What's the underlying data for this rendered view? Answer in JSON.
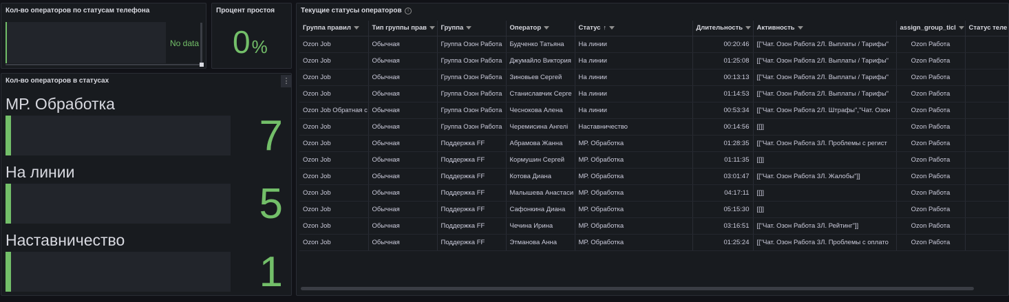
{
  "panel_phone_status": {
    "title": "Кол-во операторов по статусам телефона",
    "no_data": "No data"
  },
  "panel_idle": {
    "title": "Процент простоя",
    "value": "0",
    "unit": "%"
  },
  "panel_status_counts": {
    "title": "Кол-во операторов в статусах",
    "menu_icon": "⋮",
    "items": [
      {
        "label": "МР. Обработка",
        "value": "7"
      },
      {
        "label": "На линии",
        "value": "5"
      },
      {
        "label": "Наставничество",
        "value": "1"
      }
    ]
  },
  "panel_table": {
    "title": "Текущие статусы операторов",
    "info_icon": "i",
    "columns": [
      "Группа правил",
      "Тип группы прав",
      "Группа",
      "Оператор",
      "Статус",
      "Длительность",
      "Активность",
      "assign_group_ticl",
      "Статус теле"
    ],
    "rows": [
      [
        "Ozon Job",
        "Обычная",
        "Группа Озон Работа",
        "Будченко Татьяна",
        "На линии",
        "00:20:46",
        "[[\"Чат. Озон Работа 2Л. Выплаты / Тарифы\"",
        "Ozon Работа",
        ""
      ],
      [
        "Ozon Job",
        "Обычная",
        "Группа Озон Работа",
        "Джумайло Виктория",
        "На линии",
        "01:25:08",
        "[[\"Чат. Озон Работа 2Л. Выплаты / Тарифы\"",
        "Ozon Работа",
        ""
      ],
      [
        "Ozon Job",
        "Обычная",
        "Группа Озон Работа",
        "Зиновьев Сергей",
        "На линии",
        "00:13:13",
        "[[\"Чат. Озон Работа 2Л. Выплаты / Тарифы\"",
        "Ozon Работа",
        ""
      ],
      [
        "Ozon Job",
        "Обычная",
        "Группа Озон Работа",
        "Станиславчик Серге",
        "На линии",
        "01:14:53",
        "[[\"Чат. Озон Работа 2Л. Выплаты / Тарифы\"",
        "Ozon Работа",
        ""
      ],
      [
        "Ozon Job Обратная с",
        "Обычная",
        "Группа Озон Работа",
        "Чеснокова Алена",
        "На линии",
        "00:53:34",
        "[[\"Чат. Озон Работа 2Л. Штрафы\",\"Чат. Озон",
        "Ozon Работа",
        ""
      ],
      [
        "Ozon Job",
        "Обычная",
        "Группа Озон Работа",
        "Черемисина Ангелі",
        "Наставничество",
        "00:14:56",
        "[[]]",
        "Ozon Работа",
        ""
      ],
      [
        "Ozon Job",
        "Обычная",
        "Поддержка FF",
        "Абрамова Жанна",
        "МР. Обработка",
        "01:28:35",
        "[[\"Чат. Озон Работа 3Л. Проблемы с регист",
        "Ozon Работа",
        ""
      ],
      [
        "Ozon Job",
        "Обычная",
        "Поддержка FF",
        "Кормушин Сергей",
        "МР. Обработка",
        "01:11:35",
        "[[]]",
        "Ozon Работа",
        ""
      ],
      [
        "Ozon Job",
        "Обычная",
        "Поддержка FF",
        "Котова Диана",
        "МР. Обработка",
        "03:01:47",
        "[[\"Чат. Озон Работа 3Л. Жалобы\"]]",
        "Ozon Работа",
        ""
      ],
      [
        "Ozon Job",
        "Обычная",
        "Поддержка FF",
        "Малышева Анастаси",
        "МР. Обработка",
        "04:17:11",
        "[[]]",
        "Ozon Работа",
        ""
      ],
      [
        "Ozon Job",
        "Обычная",
        "Поддержка FF",
        "Сафонкина Диана",
        "МР. Обработка",
        "05:15:30",
        "[[]]",
        "Ozon Работа",
        ""
      ],
      [
        "Ozon Job",
        "Обычная",
        "Поддержка FF",
        "Чечина Ирина",
        "МР. Обработка",
        "03:16:51",
        "[[\"Чат. Озон Работа 3Л. Рейтинг\"]]",
        "Ozon Работа",
        ""
      ],
      [
        "Ozon Job",
        "Обычная",
        "Поддержка FF",
        "Этманова Анна",
        "МР. Обработка",
        "01:25:24",
        "[[\"Чат. Озон Работа 3Л. Проблемы с оплато",
        "Ozon Работа",
        ""
      ]
    ]
  }
}
